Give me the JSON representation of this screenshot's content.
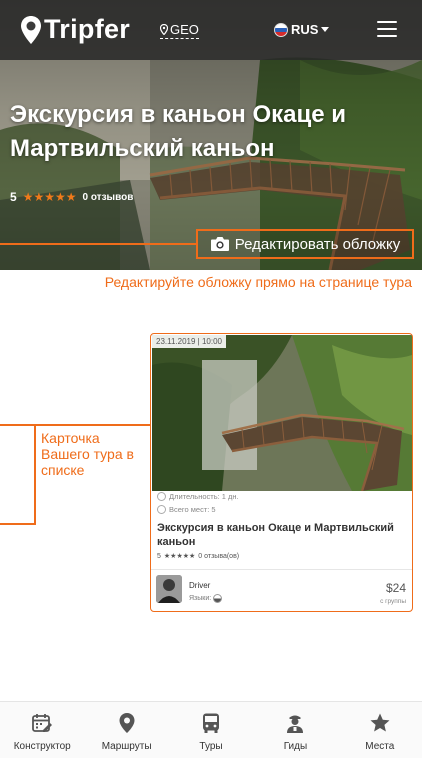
{
  "header": {
    "logo_text": "Tripfer",
    "geo_label": "GEO",
    "lang_label": "RUS"
  },
  "hero": {
    "title": "Экскурсия в каньон Окаце и Мартвильский каньон",
    "rating": "5",
    "stars": "★★★★★",
    "reviews": "0 отзывов",
    "edit_cover_label": "Редактировать обложку",
    "edit_caption": "Редактируйте обложку прямо на странице тура"
  },
  "card_label": "Карточка Вашего тура в списке",
  "tour_card": {
    "date": "23.11.2019 | 10:00",
    "duration": "Длительность: 1 дн.",
    "seats": "Всего мест: 5",
    "title": "Экскурсия в каньон Окаце и Мартвильский каньон",
    "rating": "5",
    "stars": "★★★★★",
    "reviews": "0 отзыва(ов)",
    "guide_name": "Driver",
    "languages_label": "Языки:",
    "price": "$24",
    "price_note": "с группы"
  },
  "bottom_nav": [
    {
      "label": "Конструктор",
      "icon": "calendar-edit-icon"
    },
    {
      "label": "Маршруты",
      "icon": "map-pin-icon"
    },
    {
      "label": "Туры",
      "icon": "bus-icon"
    },
    {
      "label": "Гиды",
      "icon": "guide-icon"
    },
    {
      "label": "Места",
      "icon": "star-icon"
    }
  ],
  "colors": {
    "accent": "#ef6c1a",
    "header_bg": "#282828"
  }
}
